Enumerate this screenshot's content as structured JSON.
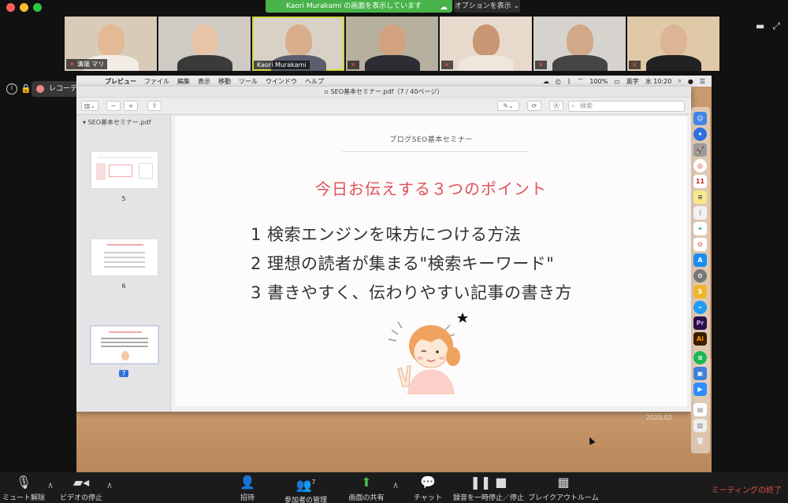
{
  "zoom": {
    "share_banner": "Kaori Murakami の画面を表示しています",
    "options_label": "オプションを表示",
    "recording_label": "レコーディング...",
    "participants": [
      {
        "name": "溝端 マリ",
        "muted": true
      },
      {
        "name": "",
        "muted": false
      },
      {
        "name": "Kaori Murakami",
        "muted": false,
        "active": true
      },
      {
        "name": "",
        "muted": true
      },
      {
        "name": "",
        "muted": true
      },
      {
        "name": "",
        "muted": true
      },
      {
        "name": "",
        "muted": true
      }
    ],
    "controls": {
      "unmute": "ミュート解除",
      "stop_video": "ビデオの停止",
      "invite": "招待",
      "manage_participants": "参加者の管理",
      "participants_count": "7",
      "share_screen": "画面の共有",
      "chat": "チャット",
      "pause_recording": "録音を一時停止／停止",
      "breakout": "ブレイクアウトルーム",
      "end_meeting": "ミーティングの終了"
    }
  },
  "mac": {
    "menu": [
      "プレビュー",
      "ファイル",
      "編集",
      "表示",
      "移動",
      "ツール",
      "ウインドウ",
      "ヘルプ"
    ],
    "battery": "100%",
    "input_method": "英字",
    "clock": "水 10:20",
    "desktop_stamp": "2020.02"
  },
  "preview": {
    "window_title": "SEO基本セミナー.pdf（7 / 40ページ）",
    "search_placeholder": "検索",
    "sidebar_file": "SEO基本セミナー.pdf",
    "thumbnails": [
      {
        "num": "5",
        "selected": false
      },
      {
        "num": "6",
        "selected": false
      },
      {
        "num": "7",
        "selected": true
      }
    ]
  },
  "slide": {
    "subtitle": "ブログSEO基本セミナー",
    "title": "今日お伝えする３つのポイント",
    "points": [
      "1  検索エンジンを味方につける方法",
      "2  理想の読者が集まる\"検索キーワード\"",
      "3  書きやすく、伝わりやすい記事の書き方"
    ]
  },
  "colors": {
    "zoom_green": "#47b34a",
    "accent_red": "#e0525a",
    "active_border": "#d3d63a",
    "end_red": "#e54d4d"
  }
}
